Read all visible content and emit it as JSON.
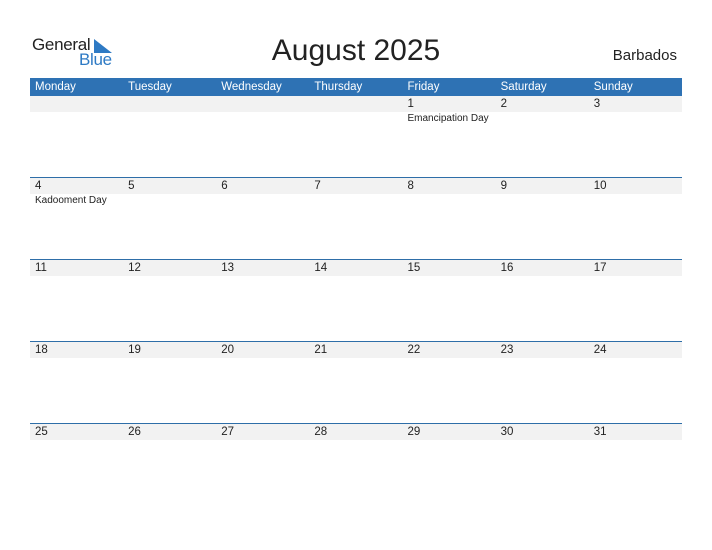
{
  "logo": {
    "general": "General",
    "blue": "Blue"
  },
  "title": "August 2025",
  "country": "Barbados",
  "colors": {
    "header": "#2e72b4",
    "accent": "#2e7ac4",
    "day_bar": "#f2f2f2"
  },
  "weekdays": [
    "Monday",
    "Tuesday",
    "Wednesday",
    "Thursday",
    "Friday",
    "Saturday",
    "Sunday"
  ],
  "weeks": [
    {
      "days": [
        "",
        "",
        "",
        "",
        "1",
        "2",
        "3"
      ],
      "events": [
        "",
        "",
        "",
        "",
        "Emancipation Day",
        "",
        ""
      ]
    },
    {
      "days": [
        "4",
        "5",
        "6",
        "7",
        "8",
        "9",
        "10"
      ],
      "events": [
        "Kadooment Day",
        "",
        "",
        "",
        "",
        "",
        ""
      ]
    },
    {
      "days": [
        "11",
        "12",
        "13",
        "14",
        "15",
        "16",
        "17"
      ],
      "events": [
        "",
        "",
        "",
        "",
        "",
        "",
        ""
      ]
    },
    {
      "days": [
        "18",
        "19",
        "20",
        "21",
        "22",
        "23",
        "24"
      ],
      "events": [
        "",
        "",
        "",
        "",
        "",
        "",
        ""
      ]
    },
    {
      "days": [
        "25",
        "26",
        "27",
        "28",
        "29",
        "30",
        "31"
      ],
      "events": [
        "",
        "",
        "",
        "",
        "",
        "",
        ""
      ]
    }
  ]
}
